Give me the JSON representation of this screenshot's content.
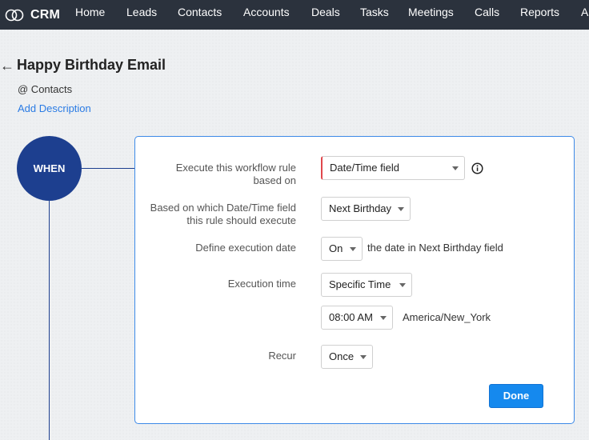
{
  "nav": {
    "brand": "CRM",
    "items": [
      "Home",
      "Leads",
      "Contacts",
      "Accounts",
      "Deals",
      "Tasks",
      "Meetings",
      "Calls",
      "Reports",
      "Ar"
    ]
  },
  "header": {
    "title": "Happy Birthday Email",
    "module": "@ Contacts",
    "add_description": "Add Description"
  },
  "timeline": {
    "when_label": "WHEN"
  },
  "form": {
    "execute_label_line1": "Execute this workflow rule",
    "execute_label_line2": "based on",
    "execute_value": "Date/Time field",
    "field_label_line1": "Based on which Date/Time field",
    "field_label_line2": "this rule should execute",
    "field_value": "Next Birthday",
    "date_label": "Define execution date",
    "date_value": "On",
    "date_suffix": "the date in Next Birthday field",
    "time_label": "Execution time",
    "time_value": "Specific Time",
    "time_clock": "08:00 AM",
    "timezone": "America/New_York",
    "recur_label": "Recur",
    "recur_value": "Once",
    "done_label": "Done"
  },
  "colors": {
    "topbar": "#2b323d",
    "accent_blue": "#1589ee",
    "when_circle": "#1d3f8f",
    "link": "#2a7be4",
    "required_marker": "#e0474c"
  },
  "icons": {
    "logo": "crm-cloud-logo",
    "back": "arrow-left-icon",
    "info": "info-icon"
  }
}
